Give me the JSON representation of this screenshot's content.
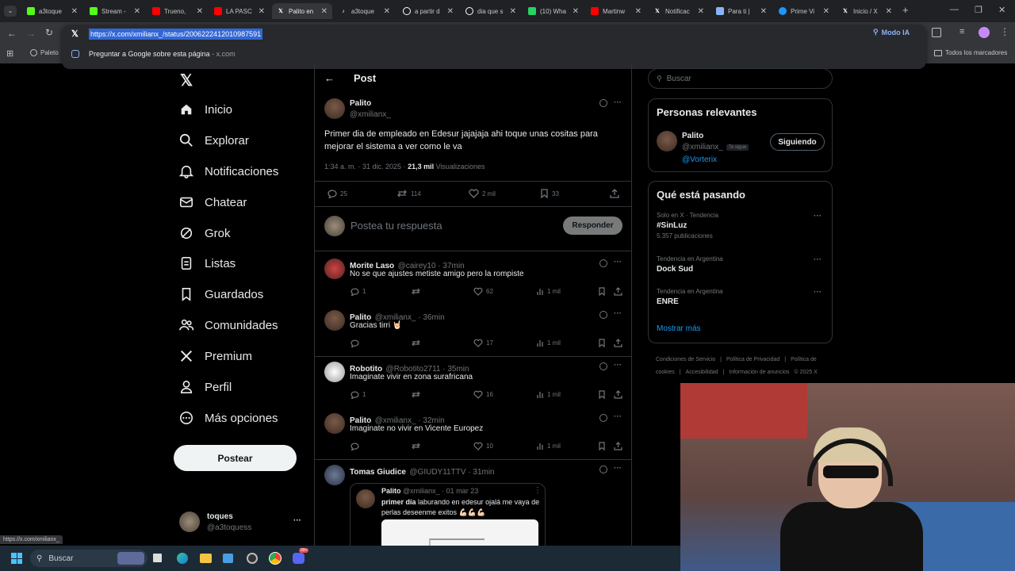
{
  "browser": {
    "tabs": [
      {
        "label": "a3toque",
        "icon": "kick-icon",
        "color": "#53fc18"
      },
      {
        "label": "Stream -",
        "icon": "kick-icon",
        "color": "#53fc18"
      },
      {
        "label": "Trueno, ",
        "icon": "youtube-icon",
        "color": "#ff0000"
      },
      {
        "label": "LA PASC",
        "icon": "youtube-icon",
        "color": "#ff0000"
      },
      {
        "label": "Palito en",
        "icon": "x-icon",
        "color": "#ffffff",
        "active": true
      },
      {
        "label": "a3toque",
        "icon": "tiktok-icon",
        "color": "#ffffff"
      },
      {
        "label": "a partir d",
        "icon": "google-icon",
        "color": "#ffffff"
      },
      {
        "label": "dia que s",
        "icon": "google-icon",
        "color": "#ffffff"
      },
      {
        "label": "(10) Wha",
        "icon": "whatsapp-icon",
        "color": "#25d366"
      },
      {
        "label": "Martinw",
        "icon": "youtube-icon",
        "color": "#ff0000"
      },
      {
        "label": "Notificac",
        "icon": "x-icon",
        "color": "#ffffff"
      },
      {
        "label": "Para ti | ",
        "icon": "tab-icon",
        "color": "#8ab4f8"
      },
      {
        "label": "Prime Vi",
        "icon": "prime-icon",
        "color": "#1a98ff"
      },
      {
        "label": "Inicio / X",
        "icon": "x-icon",
        "color": "#ffffff"
      }
    ],
    "url": "https://x.com/xmilianx_/status/2006222412010987591",
    "suggestion": "Preguntar a Google sobre esta página",
    "suggestion_domain": "x.com",
    "ai_mode": "Modo IA",
    "bookmark_first": "Paleto",
    "all_bookmarks": "Todos los marcadores",
    "status_url": "https://x.com/xmilianx_"
  },
  "nav": {
    "items": [
      "Inicio",
      "Explorar",
      "Notificaciones",
      "Chatear",
      "Grok",
      "Listas",
      "Guardados",
      "Comunidades",
      "Premium",
      "Perfil",
      "Más opciones"
    ],
    "post_button": "Postear",
    "account_name": "toques",
    "account_handle": "@a3toquess",
    "more": "···"
  },
  "post": {
    "header": "Post",
    "author": "Palito",
    "handle": "@xmilianx_",
    "text": "Primer dia de empleado en Edesur jajajaja ahi toque unas cositas para mejorar el sistema a ver como le va",
    "time": "1:34 a. m. · 31 dic. 2025 · ",
    "views_count": "21,3 mil",
    "views_label": " Visualizaciones",
    "replies": "25",
    "reposts": "114",
    "likes": "2 mil",
    "bookmarks": "33",
    "reply_placeholder": "Postea tu respuesta",
    "reply_button": "Responder"
  },
  "replies": [
    {
      "name": "Morite Laso",
      "handle": "@cairey10 · 37min",
      "text": "No se que ajustes metiste amigo pero la rompiste",
      "replies": "1",
      "reposts": "",
      "likes": "62",
      "views": "1 mil"
    },
    {
      "name": "Palito",
      "handle": "@xmilianx_ · 36min",
      "text": "Gracias tirri 🤘🏻",
      "replies": "",
      "reposts": "",
      "likes": "17",
      "views": "1 mil"
    },
    {
      "name": "Robotito",
      "handle": "@Robotito2711 · 35min",
      "text": "Imaginate vivir en zona surafricana",
      "replies": "1",
      "reposts": "",
      "likes": "16",
      "views": "1 mil"
    },
    {
      "name": "Palito",
      "handle": "@xmilianx_ · 32min",
      "text": "Imaginate no vivir en Vicente Europez",
      "replies": "",
      "reposts": "",
      "likes": "10",
      "views": "1 mil"
    },
    {
      "name": "Tomas Giudice",
      "handle": "@GIUDY11TTV · 31min",
      "text": "",
      "replies": "",
      "reposts": "",
      "likes": "",
      "views": ""
    }
  ],
  "quote": {
    "name": "Palito",
    "handle": "@xmilianx_ · 01 mar 23",
    "text_bold": "primer día",
    "text_rest": " laburando en edesur ojalá me vaya de perlas deseenme exitos 💪🏻💪🏻💪🏻"
  },
  "sidebar": {
    "search_placeholder": "Buscar",
    "relevant_title": "Personas relevantes",
    "person_name": "Palito",
    "person_handle": "@xmilianx_",
    "person_badge": "Te sigue",
    "person_bio": "@Vorterix",
    "follow_button": "Siguiendo",
    "trends_title": "Qué está pasando",
    "trends": [
      {
        "context": "Solo en X · Tendencia",
        "name": "#SinLuz",
        "count": "5.357 publicaciones"
      },
      {
        "context": "Tendencia en Argentina",
        "name": "Dock Sud",
        "count": ""
      },
      {
        "context": "Tendencia en Argentina",
        "name": "ENRE",
        "count": ""
      }
    ],
    "show_more": "Mostrar más",
    "footer": [
      "Condiciones de Servicio",
      "|",
      "Política de Privacidad",
      "|",
      "Política de cookies",
      "|",
      "Accesibilidad",
      "|",
      "Información de anuncios",
      "© 2025 X"
    ]
  },
  "taskbar": {
    "search": "Buscar",
    "badge": "99+"
  },
  "colors": {
    "accent": "#1d9bf0",
    "background": "#000000",
    "border": "#2f3336"
  }
}
